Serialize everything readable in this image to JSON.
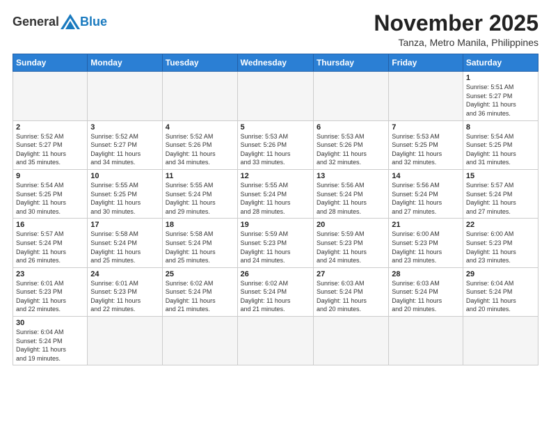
{
  "header": {
    "logo_general": "General",
    "logo_blue": "Blue",
    "month_title": "November 2025",
    "subtitle": "Tanza, Metro Manila, Philippines"
  },
  "weekdays": [
    "Sunday",
    "Monday",
    "Tuesday",
    "Wednesday",
    "Thursday",
    "Friday",
    "Saturday"
  ],
  "weeks": [
    [
      {
        "day": "",
        "info": ""
      },
      {
        "day": "",
        "info": ""
      },
      {
        "day": "",
        "info": ""
      },
      {
        "day": "",
        "info": ""
      },
      {
        "day": "",
        "info": ""
      },
      {
        "day": "",
        "info": ""
      },
      {
        "day": "1",
        "info": "Sunrise: 5:51 AM\nSunset: 5:27 PM\nDaylight: 11 hours\nand 36 minutes."
      }
    ],
    [
      {
        "day": "2",
        "info": "Sunrise: 5:52 AM\nSunset: 5:27 PM\nDaylight: 11 hours\nand 35 minutes."
      },
      {
        "day": "3",
        "info": "Sunrise: 5:52 AM\nSunset: 5:27 PM\nDaylight: 11 hours\nand 34 minutes."
      },
      {
        "day": "4",
        "info": "Sunrise: 5:52 AM\nSunset: 5:26 PM\nDaylight: 11 hours\nand 34 minutes."
      },
      {
        "day": "5",
        "info": "Sunrise: 5:53 AM\nSunset: 5:26 PM\nDaylight: 11 hours\nand 33 minutes."
      },
      {
        "day": "6",
        "info": "Sunrise: 5:53 AM\nSunset: 5:26 PM\nDaylight: 11 hours\nand 32 minutes."
      },
      {
        "day": "7",
        "info": "Sunrise: 5:53 AM\nSunset: 5:25 PM\nDaylight: 11 hours\nand 32 minutes."
      },
      {
        "day": "8",
        "info": "Sunrise: 5:54 AM\nSunset: 5:25 PM\nDaylight: 11 hours\nand 31 minutes."
      }
    ],
    [
      {
        "day": "9",
        "info": "Sunrise: 5:54 AM\nSunset: 5:25 PM\nDaylight: 11 hours\nand 30 minutes."
      },
      {
        "day": "10",
        "info": "Sunrise: 5:55 AM\nSunset: 5:25 PM\nDaylight: 11 hours\nand 30 minutes."
      },
      {
        "day": "11",
        "info": "Sunrise: 5:55 AM\nSunset: 5:24 PM\nDaylight: 11 hours\nand 29 minutes."
      },
      {
        "day": "12",
        "info": "Sunrise: 5:55 AM\nSunset: 5:24 PM\nDaylight: 11 hours\nand 28 minutes."
      },
      {
        "day": "13",
        "info": "Sunrise: 5:56 AM\nSunset: 5:24 PM\nDaylight: 11 hours\nand 28 minutes."
      },
      {
        "day": "14",
        "info": "Sunrise: 5:56 AM\nSunset: 5:24 PM\nDaylight: 11 hours\nand 27 minutes."
      },
      {
        "day": "15",
        "info": "Sunrise: 5:57 AM\nSunset: 5:24 PM\nDaylight: 11 hours\nand 27 minutes."
      }
    ],
    [
      {
        "day": "16",
        "info": "Sunrise: 5:57 AM\nSunset: 5:24 PM\nDaylight: 11 hours\nand 26 minutes."
      },
      {
        "day": "17",
        "info": "Sunrise: 5:58 AM\nSunset: 5:24 PM\nDaylight: 11 hours\nand 25 minutes."
      },
      {
        "day": "18",
        "info": "Sunrise: 5:58 AM\nSunset: 5:24 PM\nDaylight: 11 hours\nand 25 minutes."
      },
      {
        "day": "19",
        "info": "Sunrise: 5:59 AM\nSunset: 5:23 PM\nDaylight: 11 hours\nand 24 minutes."
      },
      {
        "day": "20",
        "info": "Sunrise: 5:59 AM\nSunset: 5:23 PM\nDaylight: 11 hours\nand 24 minutes."
      },
      {
        "day": "21",
        "info": "Sunrise: 6:00 AM\nSunset: 5:23 PM\nDaylight: 11 hours\nand 23 minutes."
      },
      {
        "day": "22",
        "info": "Sunrise: 6:00 AM\nSunset: 5:23 PM\nDaylight: 11 hours\nand 23 minutes."
      }
    ],
    [
      {
        "day": "23",
        "info": "Sunrise: 6:01 AM\nSunset: 5:23 PM\nDaylight: 11 hours\nand 22 minutes."
      },
      {
        "day": "24",
        "info": "Sunrise: 6:01 AM\nSunset: 5:23 PM\nDaylight: 11 hours\nand 22 minutes."
      },
      {
        "day": "25",
        "info": "Sunrise: 6:02 AM\nSunset: 5:24 PM\nDaylight: 11 hours\nand 21 minutes."
      },
      {
        "day": "26",
        "info": "Sunrise: 6:02 AM\nSunset: 5:24 PM\nDaylight: 11 hours\nand 21 minutes."
      },
      {
        "day": "27",
        "info": "Sunrise: 6:03 AM\nSunset: 5:24 PM\nDaylight: 11 hours\nand 20 minutes."
      },
      {
        "day": "28",
        "info": "Sunrise: 6:03 AM\nSunset: 5:24 PM\nDaylight: 11 hours\nand 20 minutes."
      },
      {
        "day": "29",
        "info": "Sunrise: 6:04 AM\nSunset: 5:24 PM\nDaylight: 11 hours\nand 20 minutes."
      }
    ],
    [
      {
        "day": "30",
        "info": "Sunrise: 6:04 AM\nSunset: 5:24 PM\nDaylight: 11 hours\nand 19 minutes."
      },
      {
        "day": "",
        "info": ""
      },
      {
        "day": "",
        "info": ""
      },
      {
        "day": "",
        "info": ""
      },
      {
        "day": "",
        "info": ""
      },
      {
        "day": "",
        "info": ""
      },
      {
        "day": "",
        "info": ""
      }
    ]
  ]
}
